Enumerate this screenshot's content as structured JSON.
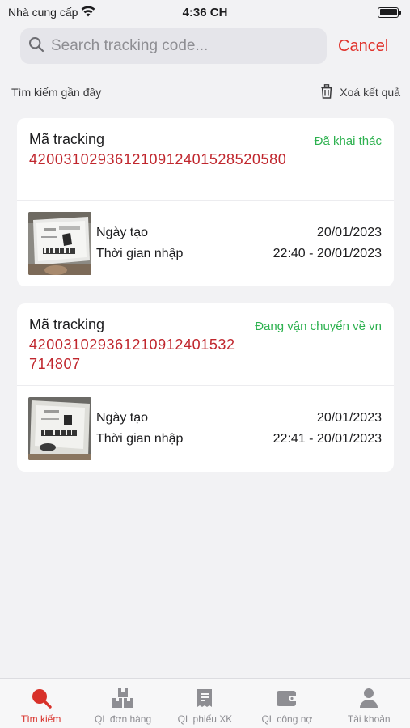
{
  "status_bar": {
    "carrier": "Nhà cung cấp",
    "time": "4:36 CH"
  },
  "search": {
    "placeholder": "Search tracking code...",
    "value": "",
    "cancel_label": "Cancel"
  },
  "recent": {
    "title": "Tìm kiếm gần đây",
    "clear_label": "Xoá kết quả"
  },
  "cards": [
    {
      "label": "Mã tracking",
      "code": "420031029361210912401528520580",
      "status": "Đã khai thác",
      "created_label": "Ngày tạo",
      "created_value": "20/01/2023",
      "import_label": "Thời gian nhập",
      "import_value": "22:40 - 20/01/2023"
    },
    {
      "label": "Mã tracking",
      "code": "420031029361210912401532714807",
      "status": "Đang vận chuyển về vn",
      "created_label": "Ngày tạo",
      "created_value": "20/01/2023",
      "import_label": "Thời gian nhập",
      "import_value": "22:41 - 20/01/2023"
    }
  ],
  "tabs": [
    {
      "label": "Tìm kiếm",
      "icon": "search-icon",
      "active": true
    },
    {
      "label": "QL đơn hàng",
      "icon": "boxes-icon",
      "active": false
    },
    {
      "label": "QL phiếu XK",
      "icon": "receipt-icon",
      "active": false
    },
    {
      "label": "QL công nợ",
      "icon": "wallet-icon",
      "active": false
    },
    {
      "label": "Tài khoản",
      "icon": "user-icon",
      "active": false
    }
  ],
  "colors": {
    "accent": "#d8312a",
    "code": "#c0262d",
    "status": "#2db14f",
    "inactive": "#8e8e93"
  }
}
